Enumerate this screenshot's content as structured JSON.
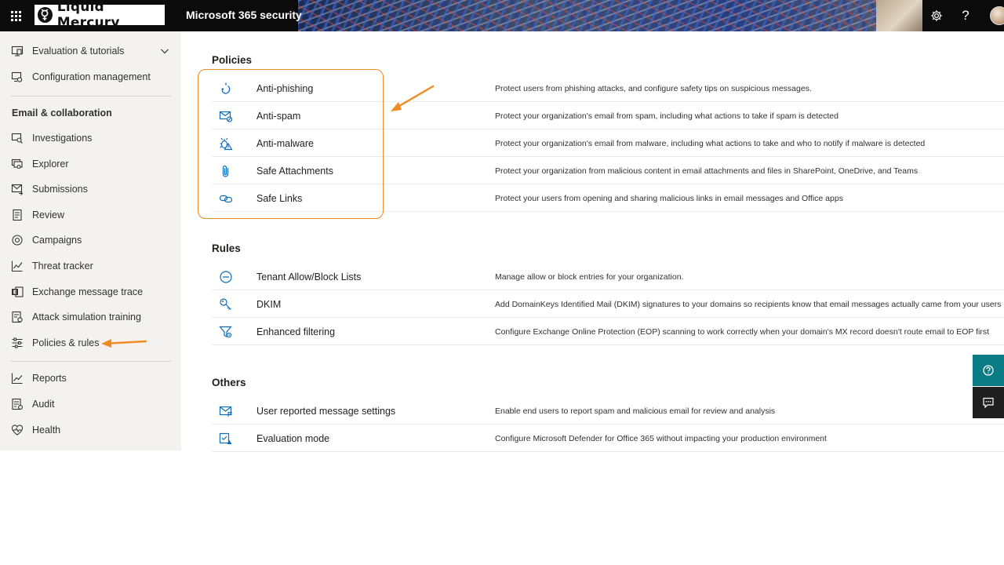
{
  "topbar": {
    "brand": "Liquid Mercury",
    "app_title": "Microsoft 365 security"
  },
  "sidebar": {
    "items_top": [
      {
        "label": "Evaluation & tutorials",
        "icon": "evaluation-icon"
      },
      {
        "label": "Configuration management",
        "icon": "configuration-icon"
      }
    ],
    "section_email": "Email & collaboration",
    "items_email": [
      {
        "label": "Investigations",
        "icon": "investigations-icon"
      },
      {
        "label": "Explorer",
        "icon": "explorer-icon"
      },
      {
        "label": "Submissions",
        "icon": "submissions-icon"
      },
      {
        "label": "Review",
        "icon": "review-icon"
      },
      {
        "label": "Campaigns",
        "icon": "campaigns-icon"
      },
      {
        "label": "Threat tracker",
        "icon": "threat-tracker-icon"
      },
      {
        "label": "Exchange message trace",
        "icon": "exchange-icon"
      },
      {
        "label": "Attack simulation training",
        "icon": "attack-simulation-icon"
      },
      {
        "label": "Policies & rules",
        "icon": "policies-icon"
      }
    ],
    "items_bottom": [
      {
        "label": "Reports",
        "icon": "reports-icon"
      },
      {
        "label": "Audit",
        "icon": "audit-icon"
      },
      {
        "label": "Health",
        "icon": "health-icon"
      }
    ]
  },
  "main": {
    "policies": {
      "title": "Policies",
      "rows": [
        {
          "name": "Anti-phishing",
          "icon": "anti-phishing-icon",
          "description": "Protect users from phishing attacks, and configure safety tips on suspicious messages."
        },
        {
          "name": "Anti-spam",
          "icon": "anti-spam-icon",
          "description": "Protect your organization's email from spam, including what actions to take if spam is detected"
        },
        {
          "name": "Anti-malware",
          "icon": "anti-malware-icon",
          "description": "Protect your organization's email from malware, including what actions to take and who to notify if malware is detected"
        },
        {
          "name": "Safe Attachments",
          "icon": "paperclip-icon",
          "description": "Protect your organization from malicious content in email attachments and files in SharePoint, OneDrive, and Teams"
        },
        {
          "name": "Safe Links",
          "icon": "link-icon",
          "description": "Protect your users from opening and sharing malicious links in email messages and Office apps"
        }
      ]
    },
    "rules": {
      "title": "Rules",
      "rows": [
        {
          "name": "Tenant Allow/Block Lists",
          "icon": "block-circle-icon",
          "description": "Manage allow or block entries for your organization."
        },
        {
          "name": "DKIM",
          "icon": "key-icon",
          "description": "Add DomainKeys Identified Mail (DKIM) signatures to your domains so recipients know that email messages actually came from your users"
        },
        {
          "name": "Enhanced filtering",
          "icon": "filter-icon",
          "description": "Configure Exchange Online Protection (EOP) scanning to work correctly when your domain's MX record doesn't route email to EOP first"
        }
      ]
    },
    "others": {
      "title": "Others",
      "rows": [
        {
          "name": "User reported message settings",
          "icon": "reported-mail-icon",
          "description": "Enable end users to report spam and malicious email for review and analysis"
        },
        {
          "name": "Evaluation mode",
          "icon": "evaluation-mode-icon",
          "description": "Configure Microsoft Defender for Office 365 without impacting your production environment"
        }
      ]
    }
  },
  "colors": {
    "accent_blue": "#0f6cbd",
    "annotation_orange": "#f08a24",
    "sidebar_bg": "#f3f2f1",
    "help_button": "#0b7b86"
  }
}
